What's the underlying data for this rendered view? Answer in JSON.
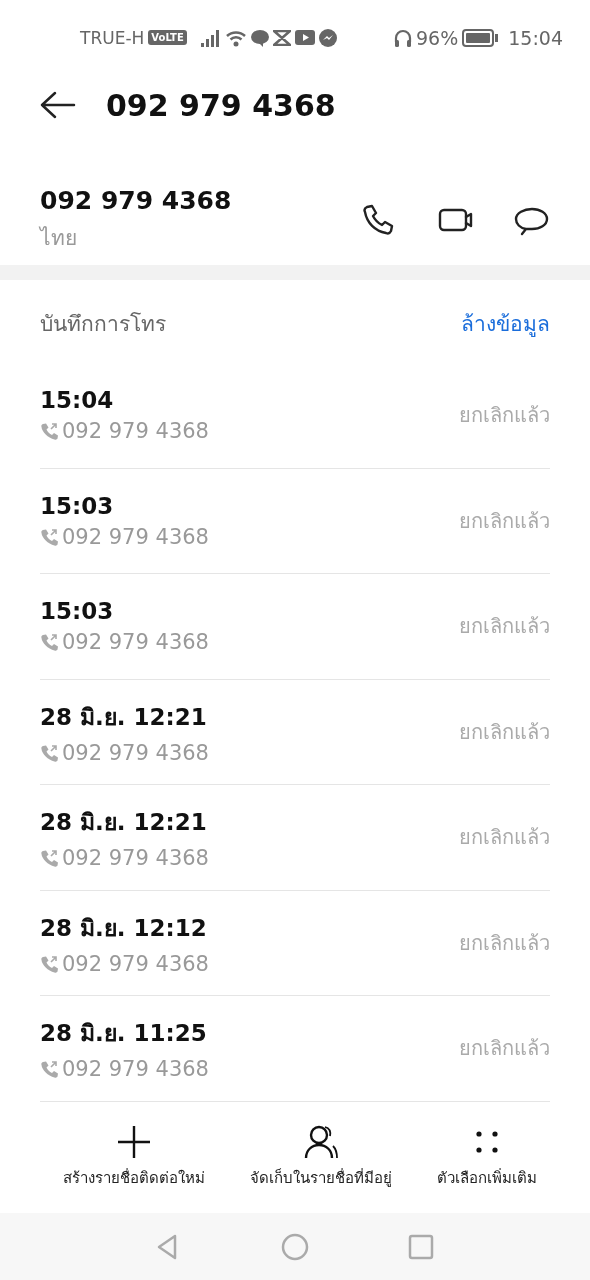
{
  "status_bar": {
    "carrier": "TRUE-H",
    "volte": "VoLTE",
    "battery": "96%",
    "time": "15:04"
  },
  "header": {
    "title": "092 979 4368"
  },
  "contact": {
    "number": "092 979 4368",
    "location": "ไทย"
  },
  "call_log": {
    "title": "บันทึกการโทร",
    "clear": "ล้างข้อมูล",
    "rows": [
      {
        "time": "15:04",
        "number": "092 979 4368",
        "status": "ยกเลิกแล้ว"
      },
      {
        "time": "15:03",
        "number": "092 979 4368",
        "status": "ยกเลิกแล้ว"
      },
      {
        "time": "15:03",
        "number": "092 979 4368",
        "status": "ยกเลิกแล้ว"
      },
      {
        "time": "28 มิ.ย. 12:21",
        "number": "092 979 4368",
        "status": "ยกเลิกแล้ว"
      },
      {
        "time": "28 มิ.ย. 12:21",
        "number": "092 979 4368",
        "status": "ยกเลิกแล้ว"
      },
      {
        "time": "28 มิ.ย. 12:12",
        "number": "092 979 4368",
        "status": "ยกเลิกแล้ว"
      },
      {
        "time": "28 มิ.ย. 11:25",
        "number": "092 979 4368",
        "status": "ยกเลิกแล้ว"
      }
    ]
  },
  "actions": [
    {
      "kind": "add",
      "label": "สร้างรายชื่อติดต่อใหม่"
    },
    {
      "kind": "person",
      "label": "จัดเก็บในรายชื่อที่มีอยู่"
    },
    {
      "kind": "more",
      "label": "ตัวเลือกเพิ่มเติม"
    }
  ]
}
